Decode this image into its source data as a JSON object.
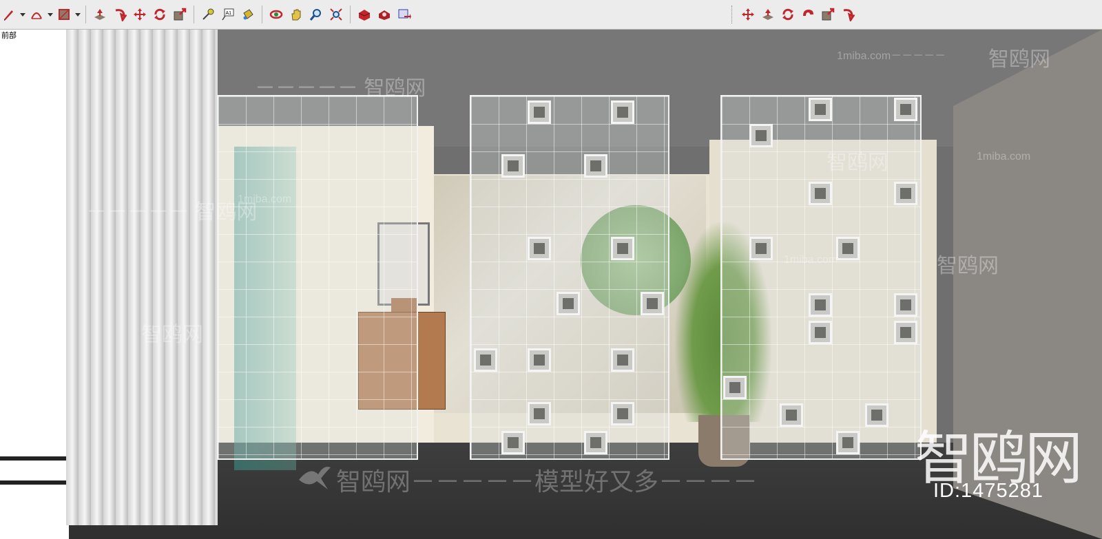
{
  "toolbar": {
    "left_tools": [
      {
        "icon": "pencil-icon"
      },
      {
        "icon": "arc-icon"
      },
      {
        "icon": "rectangle-icon"
      },
      {
        "icon": "push-pull-icon"
      },
      {
        "icon": "follow-me-icon"
      },
      {
        "icon": "move-icon"
      },
      {
        "icon": "rotate-icon"
      },
      {
        "icon": "scale-icon"
      },
      {
        "icon": "tape-measure-icon"
      },
      {
        "icon": "text-icon"
      },
      {
        "icon": "paint-bucket-icon"
      },
      {
        "icon": "orbit-icon"
      },
      {
        "icon": "pan-icon"
      },
      {
        "icon": "zoom-icon"
      },
      {
        "icon": "zoom-extents-icon"
      },
      {
        "icon": "warehouse-icon"
      },
      {
        "icon": "extension-warehouse-icon"
      },
      {
        "icon": "share-model-icon"
      }
    ],
    "right_tools": [
      {
        "icon": "move-icon"
      },
      {
        "icon": "push-pull-icon"
      },
      {
        "icon": "rotate-icon"
      },
      {
        "icon": "follow-me-icon"
      },
      {
        "icon": "scale-icon"
      },
      {
        "icon": "offset-icon"
      }
    ]
  },
  "view_label": "前部",
  "watermarks": {
    "site_cn": "智鸥网",
    "dash_cn": "－－－－－ 智鸥网",
    "domain": "1miba.com",
    "domain_dash": "1miba.com－－－－－",
    "tagline": "智鸥网－－－－－模型好又多－－－－",
    "logo_text": "智鸥网",
    "model_id": "ID:1475281"
  },
  "colors": {
    "toolbar_bg": "#ececec",
    "accent_red": "#c0262c",
    "wall_right": "#8b8782",
    "floor": "#333333"
  }
}
